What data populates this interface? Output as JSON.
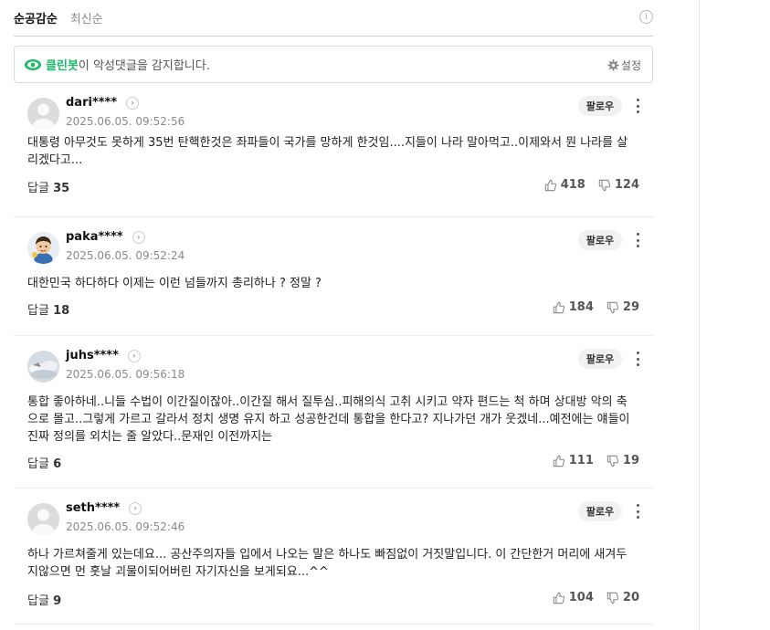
{
  "sort": {
    "tabs": [
      {
        "label": "순공감순",
        "active": true
      },
      {
        "label": "최신순",
        "active": false
      }
    ],
    "info_icon": "info-icon"
  },
  "cleanbot": {
    "name": "클린봇",
    "message": "이 악성댓글을 감지합니다.",
    "settings_label": "설정",
    "accent": "#1fb96a"
  },
  "comments": [
    {
      "username": "dari****",
      "timestamp": "2025.06.05. 09:52:56",
      "follow_label": "팔로우",
      "text": "대통령 아무것도 못하게 35번 탄핵한것은 좌파들이 국가를 망하게 한것임....지들이 나라 말아먹고..이제와서 뭔 나라를 살리겠다고...",
      "reply_label": "답글",
      "reply_count": "35",
      "likes": "418",
      "dislikes": "124"
    },
    {
      "username": "paka****",
      "timestamp": "2025.06.05. 09:52:24",
      "follow_label": "팔로우",
      "text": "대한민국 하다하다 이제는 이런 넘들까지 총리하나 ? 정말 ?",
      "reply_label": "답글",
      "reply_count": "18",
      "likes": "184",
      "dislikes": "29"
    },
    {
      "username": "juhs****",
      "timestamp": "2025.06.05. 09:56:18",
      "follow_label": "팔로우",
      "text": "통합 좋아하네..니들 수법이 이간질이잖아..이간질 해서 질투심..피해의식 고취 시키고 약자 편드는 척 하며 상대방 악의 축으로 몰고..그렇게 가르고 갈라서 정치 생명 유지 하고 성공한건데 통합을 한다고? 지나가던 개가 웃겠네...예전에는 얘들이 진짜 정의를 외치는 줄 알았다..문재인 이전까지는",
      "reply_label": "답글",
      "reply_count": "6",
      "likes": "111",
      "dislikes": "19"
    },
    {
      "username": "seth****",
      "timestamp": "2025.06.05. 09:52:46",
      "follow_label": "팔로우",
      "text": "하나 가르쳐줄게 있는데요... 공산주의자들 입에서 나오는 말은 하나도 빠짐없이 거짓말입니다. 이 간단한거 머리에 새겨두지않으면 먼 훗날 괴물이되어버린 자기자신을 보게되요...^^",
      "reply_label": "답글",
      "reply_count": "9",
      "likes": "104",
      "dislikes": "20"
    }
  ]
}
